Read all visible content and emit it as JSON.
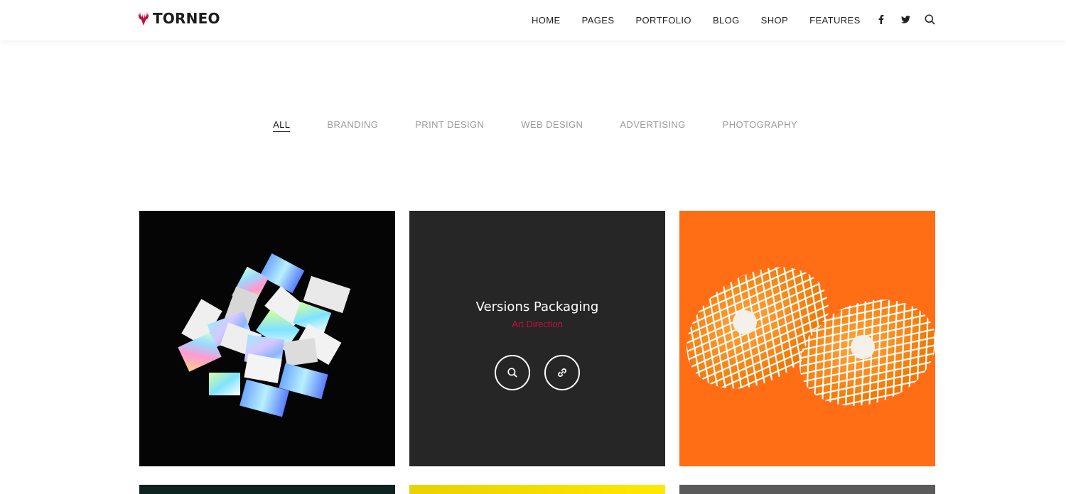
{
  "brand": {
    "name": "TORNEO",
    "logo_icon": "deer-antlers-icon",
    "accent": "#c3103a"
  },
  "nav": {
    "items": [
      {
        "label": "HOME"
      },
      {
        "label": "PAGES"
      },
      {
        "label": "PORTFOLIO"
      },
      {
        "label": "BLOG"
      },
      {
        "label": "SHOP"
      },
      {
        "label": "FEATURES"
      }
    ],
    "icons": [
      "facebook-icon",
      "twitter-icon",
      "search-icon"
    ]
  },
  "filters": {
    "active": "ALL",
    "items": [
      {
        "label": "ALL"
      },
      {
        "label": "BRANDING"
      },
      {
        "label": "PRINT DESIGN"
      },
      {
        "label": "WEB DESIGN"
      },
      {
        "label": "ADVERTISING"
      },
      {
        "label": "PHOTOGRAPHY"
      }
    ]
  },
  "portfolio": {
    "hovered": {
      "title": "Versions Packaging",
      "category": "Art Direction",
      "actions": [
        "search-icon",
        "link-icon"
      ]
    },
    "tiles": [
      {
        "image": "holographic-business-cards",
        "bg": "#050505"
      },
      {
        "image": "dark-overlay",
        "bg": "#262626"
      },
      {
        "image": "oranges-in-netting",
        "bg": "#ff6d14"
      },
      {
        "image": "dark-teal",
        "bg": "#0f2321"
      },
      {
        "image": "yellow",
        "bg": "#ffe800"
      },
      {
        "image": "grey",
        "bg": "#5a5a5a"
      }
    ]
  }
}
